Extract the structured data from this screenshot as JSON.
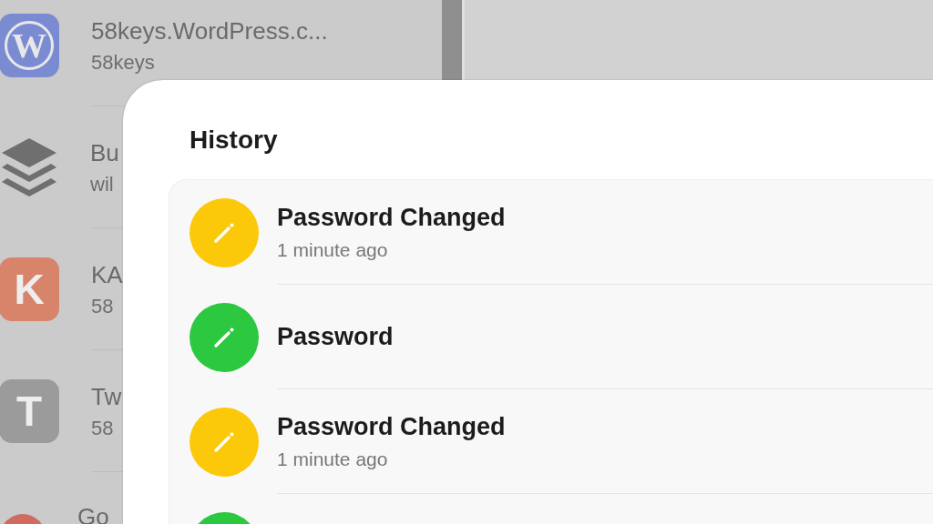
{
  "password_list": [
    {
      "kind": "circled-letter",
      "letter": "W",
      "color": "#7b8bd2",
      "title": "58keys.WordPress.c...",
      "subtitle": "58keys"
    },
    {
      "kind": "layers",
      "color": "#6f6f6f",
      "title": "Bu",
      "subtitle": "wil"
    },
    {
      "kind": "letter",
      "letter": "K",
      "color": "#d8846b",
      "title": "KA",
      "subtitle": "58"
    },
    {
      "kind": "letter",
      "letter": "T",
      "color": "#9b9b9b",
      "title": "Tw",
      "subtitle": "58"
    },
    {
      "kind": "round",
      "color": "#cf6b5f",
      "title": "Go"
    }
  ],
  "history": {
    "title": "History",
    "entries": [
      {
        "title": "Password Changed",
        "time": "1 minute ago",
        "color": "#fcc90a"
      },
      {
        "title": "Password",
        "color": "#2bc840"
      },
      {
        "title": "Password Changed",
        "time": "1 minute ago",
        "color": "#fcc90a"
      },
      {
        "color": "#2bc840"
      }
    ]
  }
}
